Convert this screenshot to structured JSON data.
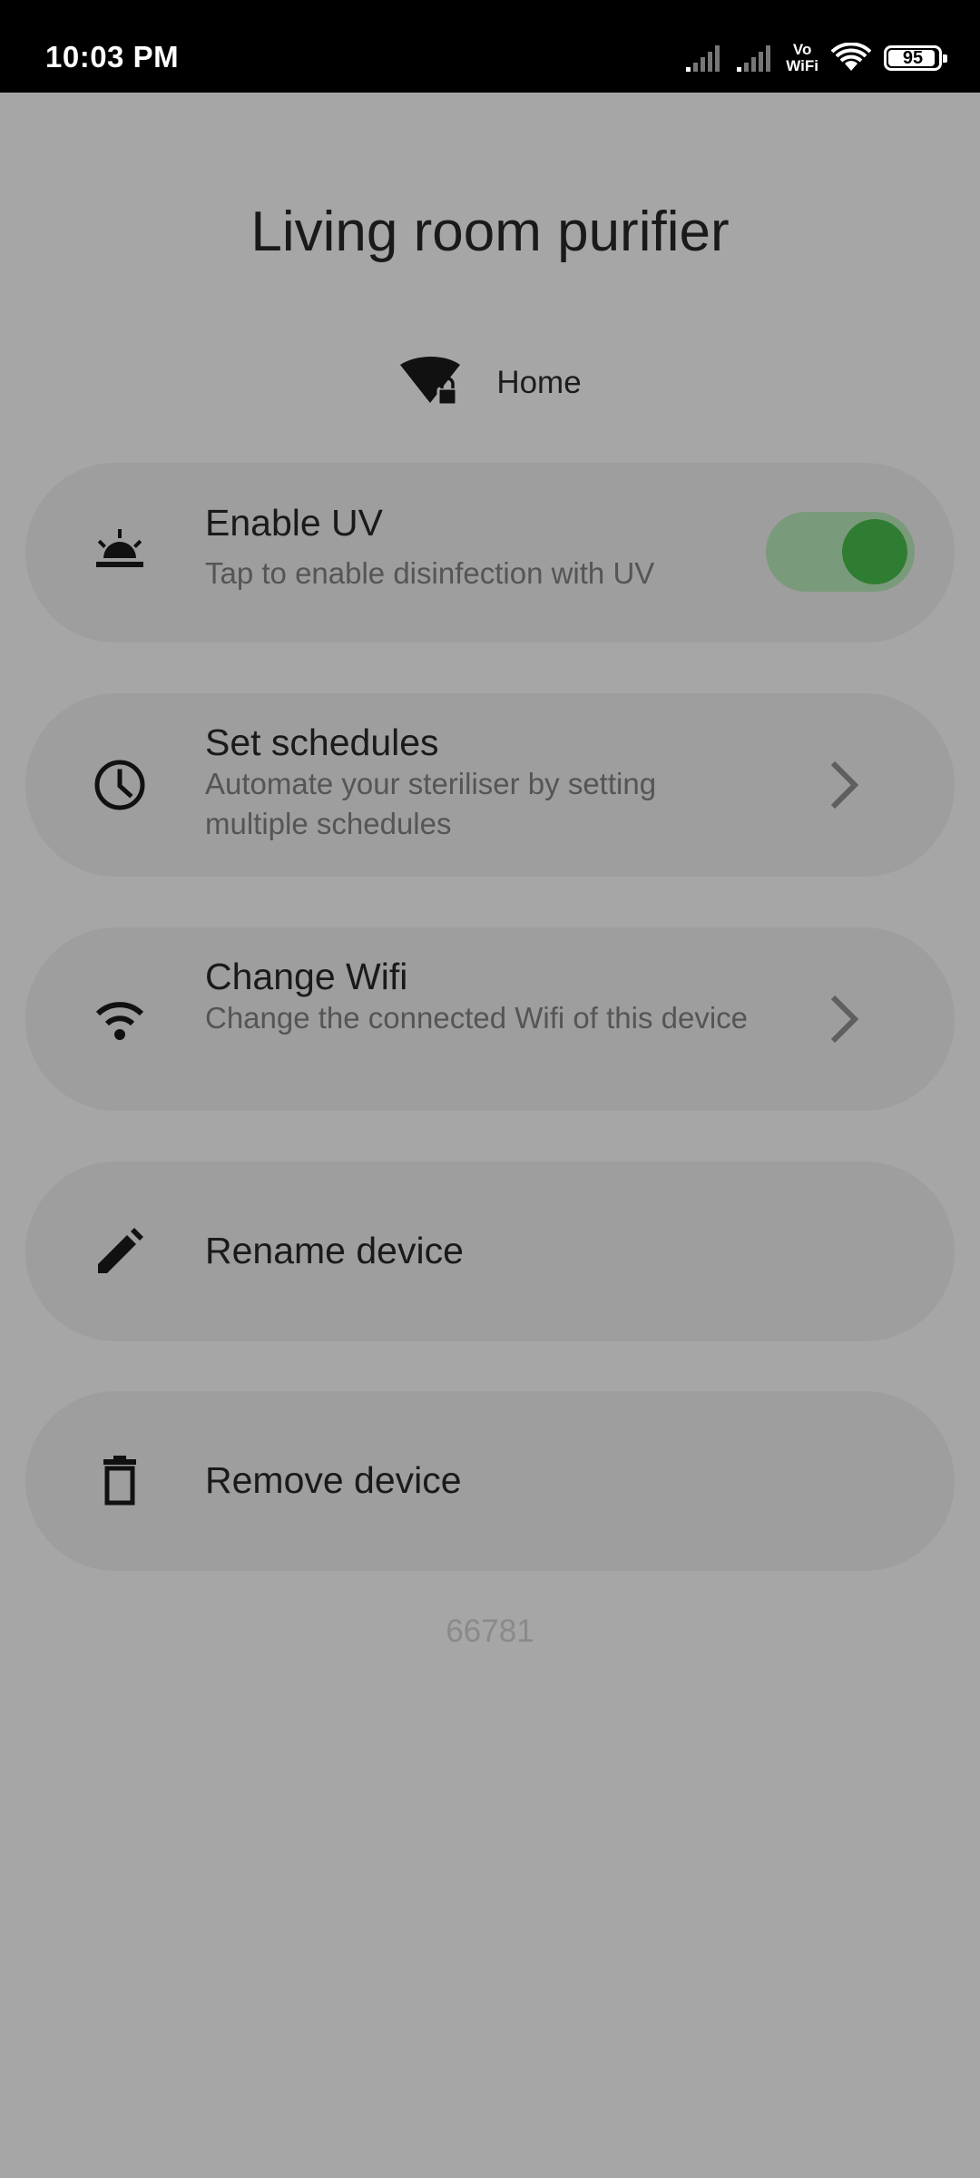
{
  "status_bar": {
    "time": "10:03 PM",
    "volte_top": "Vo",
    "volte_bottom": "WiFi",
    "battery": "95",
    "battery_fraction": 0.95
  },
  "header": {
    "title": "Living room purifier",
    "network_icon": "wifi-lock-icon",
    "network_name": "Home"
  },
  "cards": {
    "uv": {
      "icon": "sunrise-lamp-icon",
      "title": "Enable UV",
      "subtitle": "Tap to enable disinfection with UV",
      "toggle_on": true
    },
    "schedules": {
      "icon": "clock-icon",
      "title": "Set schedules",
      "subtitle": "Automate your steriliser by setting multiple schedules"
    },
    "wifi": {
      "icon": "wifi-icon",
      "title": "Change Wifi",
      "subtitle": "Change the connected Wifi of this device"
    },
    "rename": {
      "icon": "pencil-icon",
      "title": "Rename device"
    },
    "remove": {
      "icon": "trash-icon",
      "title": "Remove device"
    }
  },
  "footer": {
    "code": "66781"
  },
  "colors": {
    "background": "#a6a6a6",
    "card": "#9e9e9e",
    "toggle_track": "#7a9a7c",
    "toggle_knob": "#2f7d32"
  }
}
